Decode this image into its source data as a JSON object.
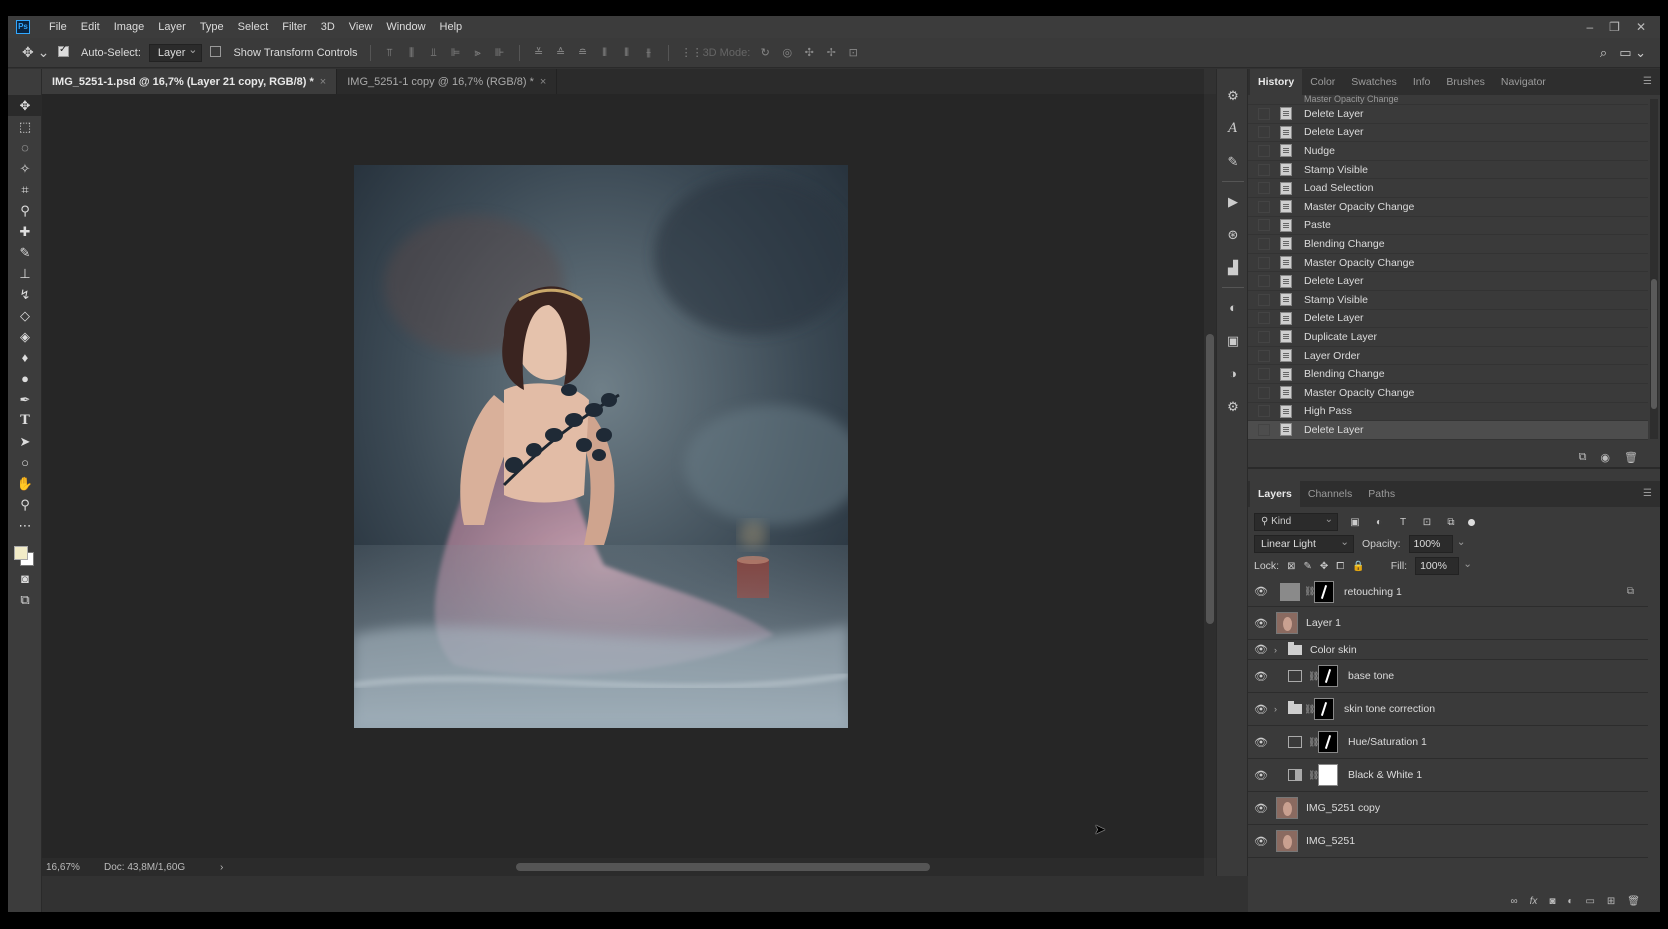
{
  "menu": [
    "File",
    "Edit",
    "Image",
    "Layer",
    "Type",
    "Select",
    "Filter",
    "3D",
    "View",
    "Window",
    "Help"
  ],
  "app_logo": "Ps",
  "window_controls": [
    "–",
    "❐",
    "✕"
  ],
  "options": {
    "auto_select_label": "Auto-Select:",
    "auto_select_value": "Layer",
    "transform_label": "Show Transform Controls",
    "mode_3d": "3D Mode:"
  },
  "tabs": [
    {
      "label": "IMG_5251-1.psd @ 16,7% (Layer 21 copy, RGB/8) *",
      "close": "×"
    },
    {
      "label": "IMG_5251-1 copy @ 16,7% (RGB/8) *",
      "close": "×"
    }
  ],
  "status": {
    "zoom": "16,67%",
    "doc": "Doc: 43,8M/1,60G",
    "arrow": "›"
  },
  "history_panel": {
    "tabs": [
      "History",
      "Color",
      "Swatches",
      "Info",
      "Brushes",
      "Navigator"
    ],
    "partial_item": "Master Opacity Change",
    "items": [
      "Delete Layer",
      "Delete Layer",
      "Nudge",
      "Stamp Visible",
      "Load Selection",
      "Master Opacity Change",
      "Paste",
      "Blending Change",
      "Master Opacity Change",
      "Delete Layer",
      "Stamp Visible",
      "Delete Layer",
      "Duplicate Layer",
      "Layer Order",
      "Blending Change",
      "Master Opacity Change",
      "High Pass",
      "Delete Layer"
    ]
  },
  "layers_panel": {
    "tabs": [
      "Layers",
      "Channels",
      "Paths"
    ],
    "kind": "Kind",
    "blend_mode": "Linear Light",
    "opacity_label": "Opacity:",
    "opacity": "100%",
    "lock_label": "Lock:",
    "fill_label": "Fill:",
    "fill": "100%",
    "layers": [
      {
        "name": "retouching 1"
      },
      {
        "name": "Layer 1"
      },
      {
        "name": "Color skin"
      },
      {
        "name": "base tone"
      },
      {
        "name": "skin tone correction"
      },
      {
        "name": "Hue/Saturation 1"
      },
      {
        "name": "Black & White 1"
      },
      {
        "name": "IMG_5251 copy"
      },
      {
        "name": "IMG_5251"
      }
    ]
  }
}
